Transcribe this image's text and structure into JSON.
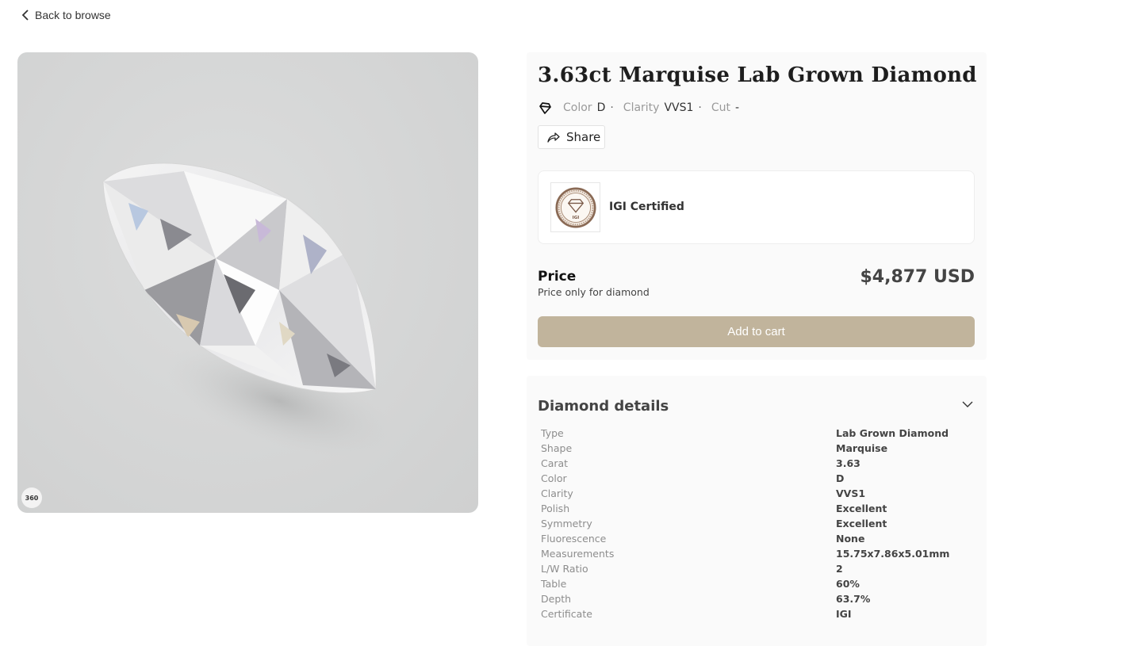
{
  "nav": {
    "back_label": "Back to browse"
  },
  "media": {
    "badge_label": "360"
  },
  "product": {
    "title": "3.63ct Marquise Lab Grown Diamond",
    "specs": [
      {
        "label": "Color",
        "value": "D",
        "sep": "·"
      },
      {
        "label": "Clarity",
        "value": "VVS1",
        "sep": "·"
      },
      {
        "label": "Cut",
        "value": "-",
        "sep": ""
      }
    ],
    "share_label": "Share"
  },
  "certificate": {
    "label": "IGI Certified",
    "logo_text": "IGI"
  },
  "price": {
    "label": "Price",
    "sub_label": "Price only for diamond",
    "value": "$4,877 USD"
  },
  "cart": {
    "button_label": "Add to cart",
    "button_color": "#c1b49c"
  },
  "details": {
    "title": "Diamond details",
    "rows": [
      {
        "key": "Type",
        "value": "Lab Grown Diamond"
      },
      {
        "key": "Shape",
        "value": "Marquise"
      },
      {
        "key": "Carat",
        "value": "3.63"
      },
      {
        "key": "Color",
        "value": "D"
      },
      {
        "key": "Clarity",
        "value": "VVS1"
      },
      {
        "key": "Polish",
        "value": "Excellent"
      },
      {
        "key": "Symmetry",
        "value": "Excellent"
      },
      {
        "key": "Fluorescence",
        "value": "None"
      },
      {
        "key": "Measurements",
        "value": "15.75x7.86x5.01mm"
      },
      {
        "key": "L/W Ratio",
        "value": "2"
      },
      {
        "key": "Table",
        "value": "60%"
      },
      {
        "key": "Depth",
        "value": "63.7%"
      },
      {
        "key": "Certificate",
        "value": "IGI"
      }
    ]
  }
}
